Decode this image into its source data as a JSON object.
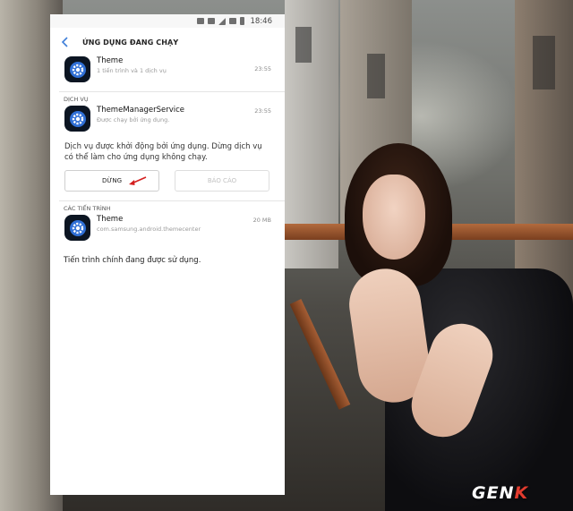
{
  "status_bar": {
    "time": "18:46"
  },
  "header": {
    "title": "ỨNG DỤNG ĐANG CHẠY"
  },
  "app_row": {
    "title": "Theme",
    "subtitle": "1 tiến trình và 1 dịch vụ",
    "time": "23:55",
    "icon": "settings-gear-icon"
  },
  "services": {
    "label": "DỊCH VỤ",
    "item": {
      "title": "ThemeManagerService",
      "subtitle": "Được chạy bởi ứng dụng.",
      "time": "23:55",
      "icon": "settings-gear-icon"
    },
    "description": "Dịch vụ được khởi động bởi ứng dụng. Dừng dịch vụ có thể làm cho ứng dụng không chạy.",
    "stop_button": "DỪNG",
    "report_button": "BÁO CÁO"
  },
  "processes": {
    "label": "CÁC TIẾN TRÌNH",
    "item": {
      "title": "Theme",
      "subtitle": "com.samsung.android.themecenter",
      "size": "20 MB",
      "icon": "settings-gear-icon"
    },
    "status_text": "Tiến trình chính đang được sử dụng."
  },
  "watermark": {
    "text_main": "GEN",
    "text_accent": "K"
  },
  "colors": {
    "accent_blue": "#3f7fd9",
    "app_icon_bg": "#0c1522",
    "arrow_red": "#d41f1f",
    "watermark_red": "#e23b2e"
  }
}
